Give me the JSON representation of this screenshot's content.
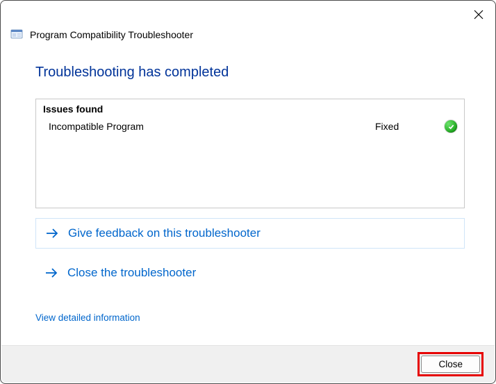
{
  "window": {
    "title": "Program Compatibility Troubleshooter"
  },
  "main": {
    "heading": "Troubleshooting has completed",
    "issues_header": "Issues found",
    "issues": [
      {
        "name": "Incompatible Program",
        "status": "Fixed",
        "icon": "check"
      }
    ]
  },
  "options": {
    "feedback": "Give feedback on this troubleshooter",
    "close_troubleshooter": "Close the troubleshooter",
    "view_details": "View detailed information"
  },
  "footer": {
    "close_button": "Close"
  }
}
